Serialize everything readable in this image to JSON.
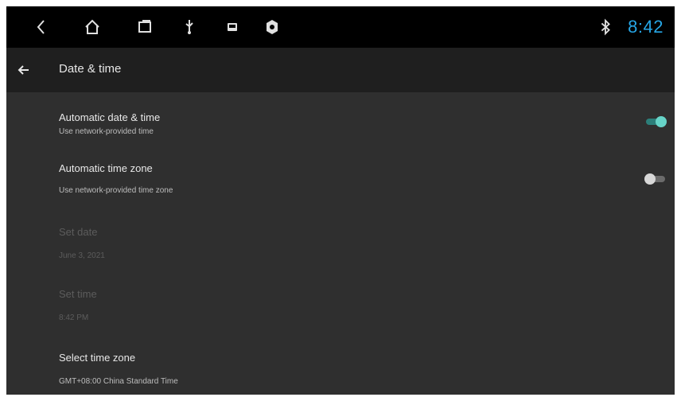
{
  "status_bar": {
    "time": "8:42",
    "accent_color": "#26a6e6",
    "icons": [
      "back-nav-icon",
      "home-icon",
      "recents-icon",
      "usb-icon",
      "image-icon",
      "settings-notification-icon",
      "bluetooth-icon"
    ]
  },
  "app_bar": {
    "title": "Date & time",
    "back_icon": "arrow-left-icon"
  },
  "settings": {
    "auto_datetime": {
      "title": "Automatic date & time",
      "subtitle": "Use network-provided time",
      "enabled": true
    },
    "auto_timezone": {
      "title": "Automatic time zone",
      "subtitle": "Use network-provided time zone",
      "enabled": false
    },
    "set_date": {
      "title": "Set date",
      "value": "June 3, 2021",
      "disabled": true
    },
    "set_time": {
      "title": "Set time",
      "value": "8:42 PM",
      "disabled": true
    },
    "select_timezone": {
      "title": "Select time zone",
      "value": "GMT+08:00 China Standard Time"
    }
  },
  "colors": {
    "background": "#2f2f2f",
    "app_bar": "#1f1f1f",
    "status_bar": "#000000",
    "toggle_on": "#67d4c8"
  }
}
